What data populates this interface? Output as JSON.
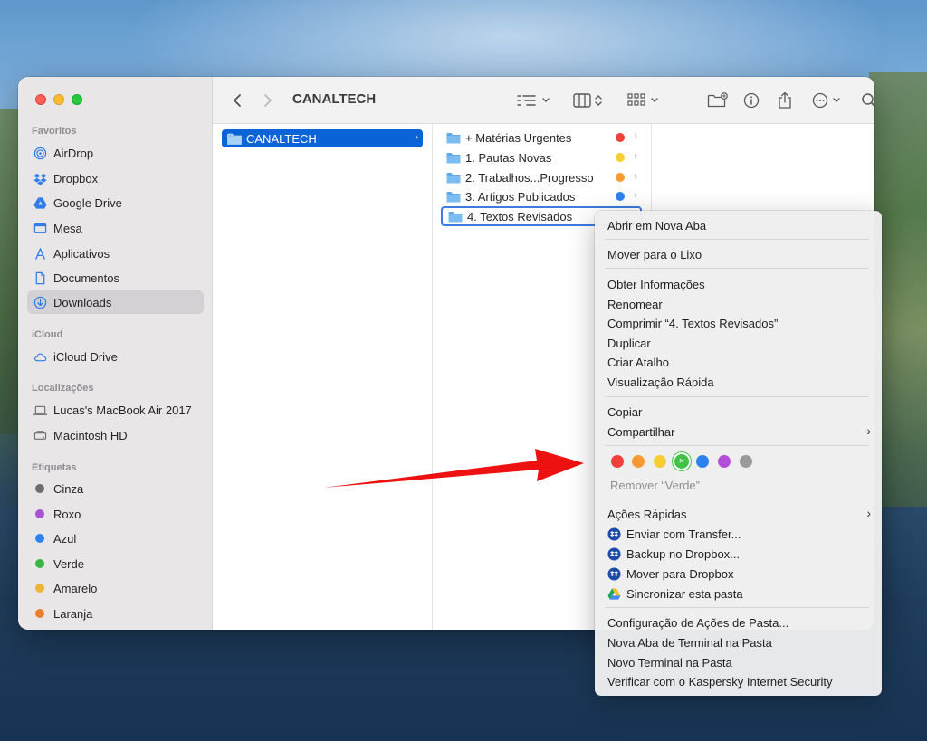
{
  "colors": {
    "accent": "#0b63d8",
    "tag_red": "#f0403c",
    "tag_orange": "#f89a33",
    "tag_yellow": "#f8cd33",
    "tag_green": "#3fc245",
    "tag_blue": "#2e82f0",
    "tag_purple": "#b34fd6",
    "tag_gray": "#9a9a9c",
    "annotation_arrow": "#ee1111"
  },
  "sidebar": {
    "favorites_title": "Favoritos",
    "favorites": [
      {
        "label": "AirDrop",
        "icon": "airdrop-icon"
      },
      {
        "label": "Dropbox",
        "icon": "dropbox-icon"
      },
      {
        "label": "Google Drive",
        "icon": "google-drive-icon"
      },
      {
        "label": "Mesa",
        "icon": "desktop-icon"
      },
      {
        "label": "Aplicativos",
        "icon": "applications-icon"
      },
      {
        "label": "Documentos",
        "icon": "document-icon"
      },
      {
        "label": "Downloads",
        "icon": "download-icon"
      }
    ],
    "icloud_title": "iCloud",
    "icloud": [
      {
        "label": "iCloud Drive",
        "icon": "cloud-icon"
      }
    ],
    "locations_title": "Localizações",
    "locations": [
      {
        "label": "Lucas's MacBook Air 2017",
        "icon": "laptop-icon"
      },
      {
        "label": "Macintosh HD",
        "icon": "disk-icon"
      }
    ],
    "tags_title": "Etiquetas",
    "tags": [
      {
        "label": "Cinza",
        "color": "#6e6e70"
      },
      {
        "label": "Roxo",
        "color": "#a556cf"
      },
      {
        "label": "Azul",
        "color": "#2e82f0"
      },
      {
        "label": "Verde",
        "color": "#3fb346"
      },
      {
        "label": "Amarelo",
        "color": "#e9b734"
      },
      {
        "label": "Laranja",
        "color": "#e8812f"
      }
    ]
  },
  "toolbar": {
    "title": "CANALTECH",
    "icons": [
      "back-icon",
      "forward-icon",
      "list-view-icon",
      "column-view-icon",
      "gallery-view-icon",
      "new-folder-icon",
      "info-icon",
      "share-icon",
      "more-icon",
      "search-icon"
    ]
  },
  "column1": {
    "items": [
      {
        "label": "CANALTECH"
      }
    ]
  },
  "column2": {
    "items": [
      {
        "label": "+ Matérias Urgentes",
        "tag": "#f0403c"
      },
      {
        "label": "1. Pautas Novas",
        "tag": "#f8cd33"
      },
      {
        "label": "2. Trabalhos...Progresso",
        "tag": "#f89a33"
      },
      {
        "label": "3. Artigos Publicados",
        "tag": "#2e82f0"
      },
      {
        "label": "4. Textos Revisados",
        "tag": ""
      }
    ]
  },
  "context_menu": {
    "open_new_tab": "Abrir em Nova Aba",
    "move_trash": "Mover para o Lixo",
    "get_info": "Obter Informações",
    "rename": "Renomear",
    "compress": "Comprimir “4. Textos Revisados”",
    "duplicate": "Duplicar",
    "make_alias": "Criar Atalho",
    "quick_look": "Visualização Rápida",
    "copy": "Copiar",
    "share": "Compartilhar",
    "remove_tag": "Remover “Verde”",
    "quick_actions": "Ações Rápidas",
    "send_transfer": "Enviar com Transfer...",
    "backup_dropbox": "Backup no Dropbox...",
    "move_dropbox": "Mover para Dropbox",
    "sync_folder": "Sincronizar esta pasta",
    "folder_actions": "Configuração de Ações de Pasta...",
    "new_terminal_tab": "Nova Aba de Terminal na Pasta",
    "new_terminal": "Novo Terminal na Pasta",
    "kaspersky": "Verificar com o Kaspersky Internet Security"
  }
}
